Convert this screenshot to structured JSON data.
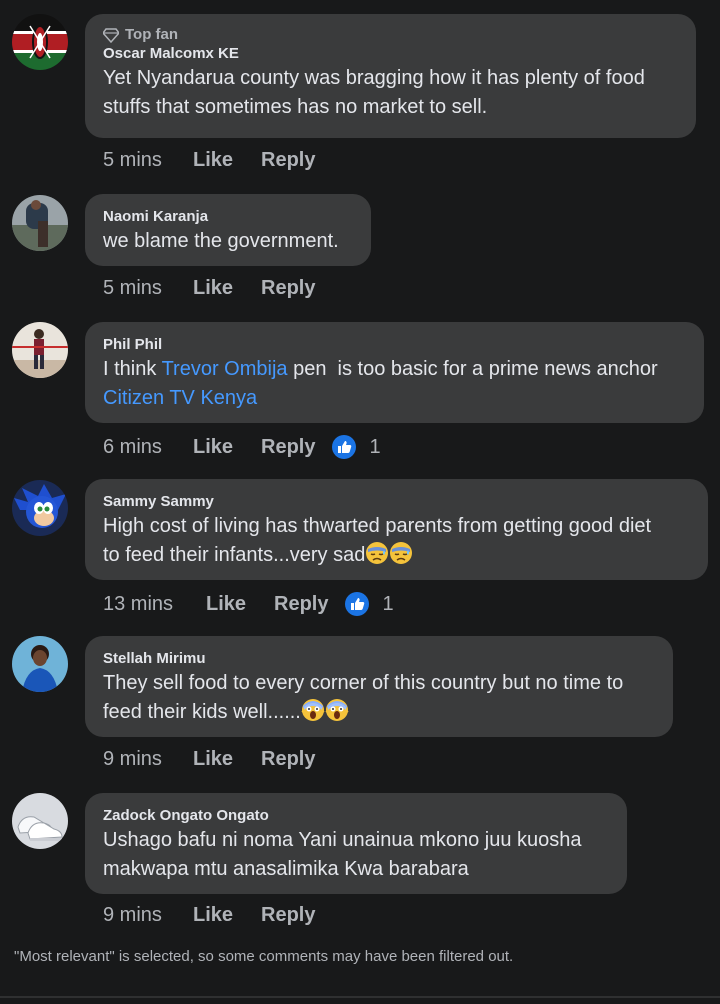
{
  "comments": [
    {
      "badge": "Top fan",
      "name": "Oscar Malcomx KE",
      "line1": "Yet Nyandarua county was bragging how it has plenty of food",
      "line2": "stuffs that sometimes has no market to sell.",
      "time": "5 mins",
      "like": "Like",
      "reply": "Reply"
    },
    {
      "name": "Naomi Karanja",
      "line1": "we blame the government.",
      "time": "5 mins",
      "like": "Like",
      "reply": "Reply"
    },
    {
      "name": "Phil Phil",
      "line1_pre": "I think ",
      "line1_link": "Trevor Ombija",
      "line1_post": " pen  is too basic for a prime news anchor",
      "line2_link": "Citizen TV Kenya",
      "time": "6 mins",
      "like": "Like",
      "reply": "Reply",
      "reaction_count": "1"
    },
    {
      "name": "Sammy Sammy",
      "line1": "High cost of living has thwarted parents from getting good diet",
      "line2": "to feed their infants...very sad",
      "time": "13 mins",
      "like": "Like",
      "reply": "Reply",
      "reaction_count": "1"
    },
    {
      "name": "Stellah Mirimu",
      "line1": "They sell food to every corner of this country but no time to",
      "line2": "feed their kids well......",
      "time": "9 mins",
      "like": "Like",
      "reply": "Reply"
    },
    {
      "name": "Zadock Ongato Ongato",
      "line1": "Ushago bafu ni noma Yani unainua mkono juu kuosha",
      "line2": "makwapa mtu anasalimika Kwa barabara",
      "time": "9 mins",
      "like": "Like",
      "reply": "Reply"
    }
  ],
  "footer": "\"Most relevant\" is selected, so some comments may have been filtered out.",
  "icons": {
    "badge": "diamond-icon",
    "reaction": "thumbs-up-icon",
    "emoji_sad": "downcast-sweat-emoji",
    "emoji_scream": "screaming-face-emoji"
  },
  "colors": {
    "background": "#18191a",
    "bubble": "#3a3b3c",
    "link": "#4599ff",
    "secondary_text": "#b0b3b8"
  }
}
